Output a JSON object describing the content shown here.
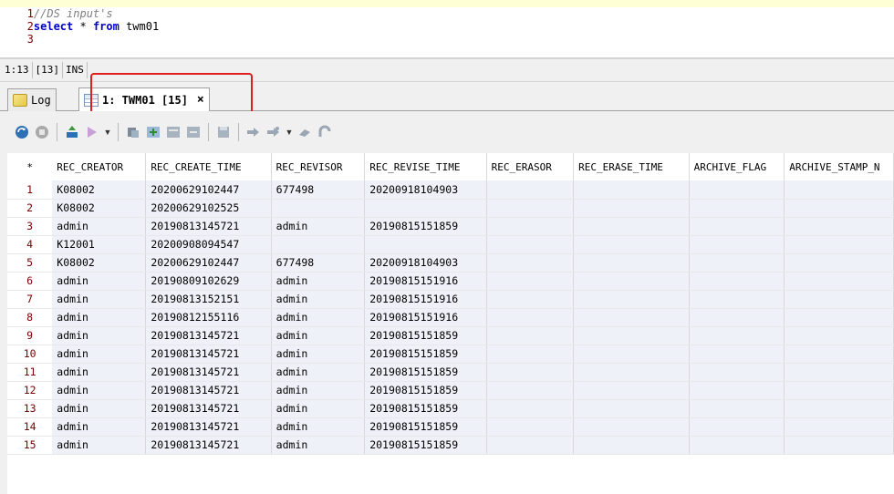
{
  "editor": {
    "lines": [
      {
        "num": "1",
        "text": "//DS input's"
      },
      {
        "num": "2",
        "kw1": "select",
        "mid": " * ",
        "kw2": "from",
        "rest": " twm01"
      },
      {
        "num": "3",
        "text": ""
      }
    ]
  },
  "status": {
    "position": "1:13",
    "length": "[13]",
    "mode": "INS"
  },
  "tabs": [
    {
      "label": "Log",
      "icon": "log-icon"
    },
    {
      "label": "1: TWM01 [15]",
      "icon": "grid-icon",
      "close": "×"
    }
  ],
  "toolbar": {
    "icons": [
      "refresh-icon",
      "stop-icon",
      "export-icon",
      "filter-icon",
      "dropdown-icon",
      "copy-icon",
      "add-row-icon",
      "duplicate-row-icon",
      "delete-row-icon",
      "save-icon",
      "commit-icon",
      "rollback-icon",
      "dropdown-icon",
      "cancel-icon",
      "undo-icon"
    ]
  },
  "grid": {
    "row_header": "*",
    "columns": [
      "REC_CREATOR",
      "REC_CREATE_TIME",
      "REC_REVISOR",
      "REC_REVISE_TIME",
      "REC_ERASOR",
      "REC_ERASE_TIME",
      "ARCHIVE_FLAG",
      "ARCHIVE_STAMP_N"
    ],
    "rows": [
      [
        "1",
        "K08002",
        "20200629102447",
        "677498",
        "20200918104903",
        "",
        "",
        "",
        ""
      ],
      [
        "2",
        "K08002",
        "20200629102525",
        "",
        "",
        "",
        "",
        "",
        ""
      ],
      [
        "3",
        "admin",
        "20190813145721",
        "admin",
        "20190815151859",
        "",
        "",
        "",
        ""
      ],
      [
        "4",
        "K12001",
        "20200908094547",
        "",
        "",
        "",
        "",
        "",
        ""
      ],
      [
        "5",
        "K08002",
        "20200629102447",
        "677498",
        "20200918104903",
        "",
        "",
        "",
        ""
      ],
      [
        "6",
        "admin",
        "20190809102629",
        "admin",
        "20190815151916",
        "",
        "",
        "",
        ""
      ],
      [
        "7",
        "admin",
        "20190813152151",
        "admin",
        "20190815151916",
        "",
        "",
        "",
        ""
      ],
      [
        "8",
        "admin",
        "20190812155116",
        "admin",
        "20190815151916",
        "",
        "",
        "",
        ""
      ],
      [
        "9",
        "admin",
        "20190813145721",
        "admin",
        "20190815151859",
        "",
        "",
        "",
        ""
      ],
      [
        "10",
        "admin",
        "20190813145721",
        "admin",
        "20190815151859",
        "",
        "",
        "",
        ""
      ],
      [
        "11",
        "admin",
        "20190813145721",
        "admin",
        "20190815151859",
        "",
        "",
        "",
        ""
      ],
      [
        "12",
        "admin",
        "20190813145721",
        "admin",
        "20190815151859",
        "",
        "",
        "",
        ""
      ],
      [
        "13",
        "admin",
        "20190813145721",
        "admin",
        "20190815151859",
        "",
        "",
        "",
        ""
      ],
      [
        "14",
        "admin",
        "20190813145721",
        "admin",
        "20190815151859",
        "",
        "",
        "",
        ""
      ],
      [
        "15",
        "admin",
        "20190813145721",
        "admin",
        "20190815151859",
        "",
        "",
        "",
        ""
      ]
    ]
  },
  "colors": {
    "highlight": "#e02020",
    "row_bg": "#eef2f8",
    "rownum": "#7a0000",
    "keyword": "#0000cc"
  }
}
